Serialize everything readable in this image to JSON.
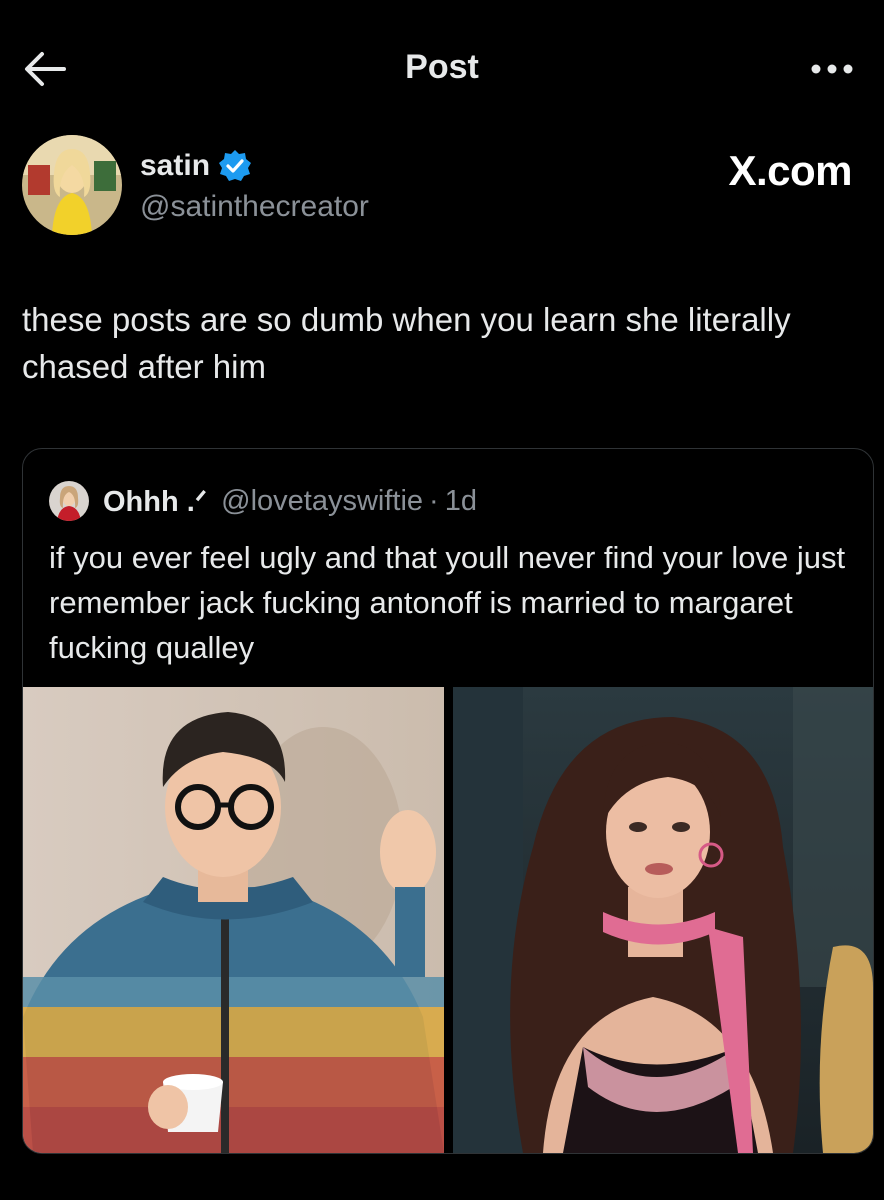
{
  "header": {
    "back_icon": "arrow-left-icon",
    "title": "Post",
    "more_icon": "more-horizontal-icon"
  },
  "post": {
    "author": {
      "name": "satin",
      "handle": "@satinthecreator",
      "verified": true,
      "verified_color": "#1d9bf0"
    },
    "watermark": "X.com",
    "text": "these posts are so dumb when you learn she literally chased after him"
  },
  "quoted_post": {
    "author": {
      "name": "Ohhh .ᐟ",
      "handle": "@lovetayswiftie",
      "separator": "·",
      "time": "1d"
    },
    "text": "if you ever feel ugly and that youll never find your love just remember jack fucking antonoff is married to margaret fucking qualley",
    "media": [
      {
        "kind": "photo",
        "icon": "photo-man-glasses-jacket"
      },
      {
        "kind": "photo",
        "icon": "photo-woman-pink-scarf"
      }
    ]
  },
  "colors": {
    "background": "#000000",
    "text_primary": "#e7e9ea",
    "text_secondary": "#8b9198",
    "border": "#2f3336",
    "verified": "#1d9bf0"
  }
}
